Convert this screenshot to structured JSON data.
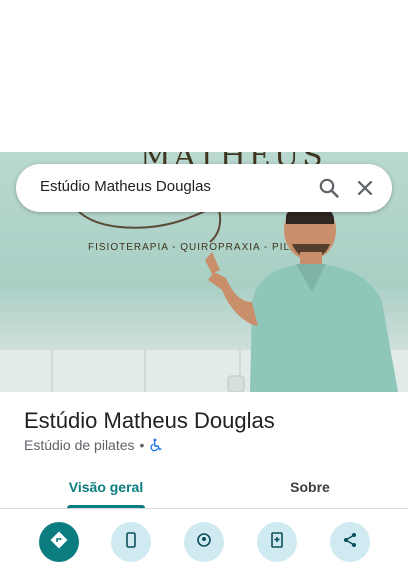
{
  "search": {
    "value": "Estúdio Matheus Douglas"
  },
  "place": {
    "title": "Estúdio Matheus Douglas",
    "category": "Estúdio de pilates",
    "separator": "•",
    "photo_sign": {
      "heading": "MATHEUS",
      "tagline": "FISIOTERAPIA - QUIROPRAXIA - PILATES"
    }
  },
  "tabs": [
    {
      "label": "Visão geral",
      "selected": true
    },
    {
      "label": "Sobre",
      "selected": false
    }
  ],
  "actions": [
    {
      "icon": "directions-icon"
    },
    {
      "icon": "phone-icon"
    },
    {
      "icon": "location-icon"
    },
    {
      "icon": "save-icon"
    },
    {
      "icon": "share-icon"
    }
  ],
  "colors": {
    "accent": "#0b7d80",
    "action_bg": "#cfeaf0",
    "wall": "#b9d9d0",
    "wheelchair": "#1a73e8"
  }
}
